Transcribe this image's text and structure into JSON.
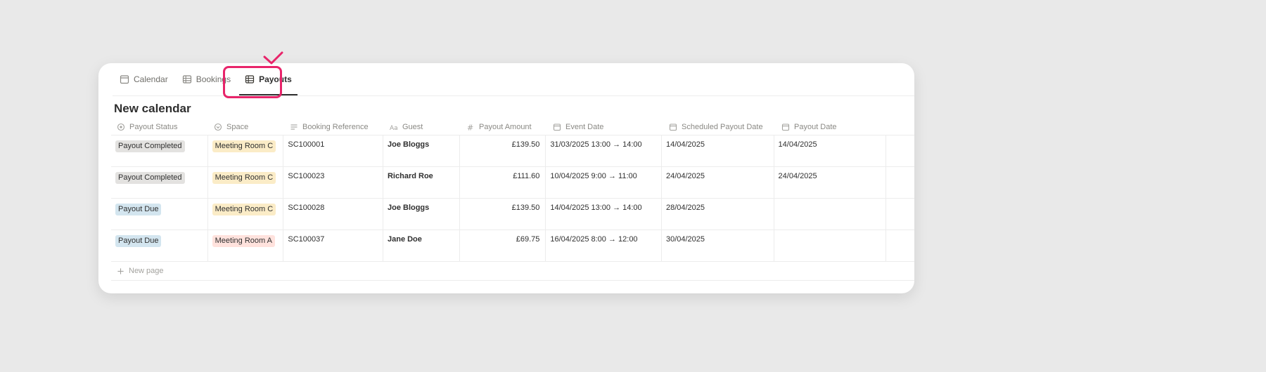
{
  "tabs": [
    {
      "label": "Calendar",
      "icon": "calendar-icon"
    },
    {
      "label": "Bookings",
      "icon": "table-icon"
    },
    {
      "label": "Payouts",
      "icon": "table-icon",
      "active": true
    }
  ],
  "view_title": "New calendar",
  "columns": [
    {
      "label": "Payout Status",
      "icon": "status-icon"
    },
    {
      "label": "Space",
      "icon": "select-icon"
    },
    {
      "label": "Booking Reference",
      "icon": "text-icon"
    },
    {
      "label": "Guest",
      "icon": "title-icon"
    },
    {
      "label": "Payout Amount",
      "icon": "number-icon"
    },
    {
      "label": "Event Date",
      "icon": "date-icon"
    },
    {
      "label": "Scheduled Payout Date",
      "icon": "date-icon"
    },
    {
      "label": "Payout Date",
      "icon": "date-icon"
    }
  ],
  "rows": [
    {
      "status": "Payout Completed",
      "space": "Meeting Room C",
      "ref": "SC100001",
      "guest": "Joe Bloggs",
      "amount": "£139.50",
      "event": "31/03/2025 13:00 → 14:00",
      "scheduled": "14/04/2025",
      "payout": "14/04/2025"
    },
    {
      "status": "Payout Completed",
      "space": "Meeting Room C",
      "ref": "SC100023",
      "guest": "Richard Roe",
      "amount": "£111.60",
      "event": "10/04/2025 9:00 → 11:00",
      "scheduled": "24/04/2025",
      "payout": "24/04/2025"
    },
    {
      "status": "Payout Due",
      "space": "Meeting Room C",
      "ref": "SC100028",
      "guest": "Joe Bloggs",
      "amount": "£139.50",
      "event": "14/04/2025 13:00 → 14:00",
      "scheduled": "28/04/2025",
      "payout": ""
    },
    {
      "status": "Payout Due",
      "space": "Meeting Room A",
      "ref": "SC100037",
      "guest": "Jane Doe",
      "amount": "£69.75",
      "event": "16/04/2025 8:00 → 12:00",
      "scheduled": "30/04/2025",
      "payout": ""
    }
  ],
  "new_page_label": "New page",
  "colors": {
    "highlight": "#e8246a",
    "status_completed_bg": "#e3e2e0",
    "status_due_bg": "#d3e5ef",
    "room_c_bg": "#fbecc7",
    "room_a_bg": "#ffe2dd"
  }
}
